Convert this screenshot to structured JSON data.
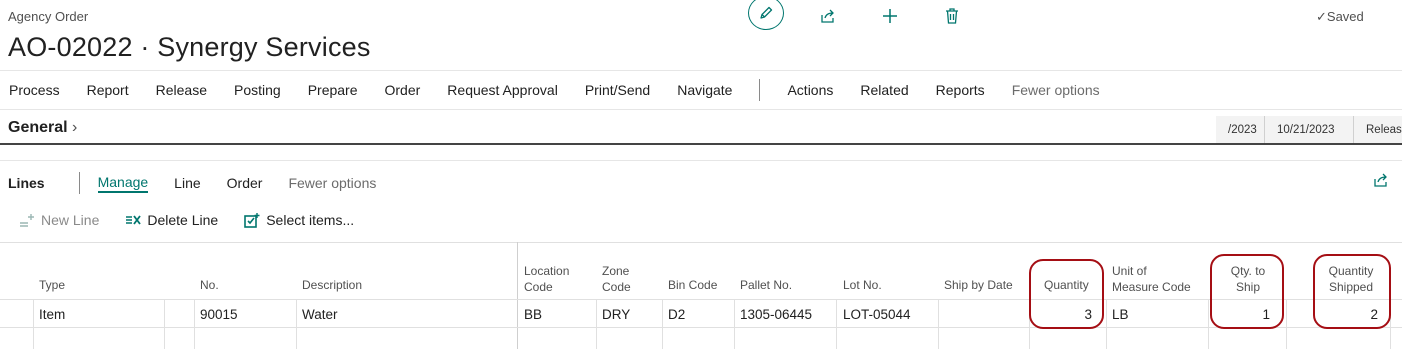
{
  "header": {
    "breadcrumb": "Agency Order",
    "title": "AO-02022 · Synergy Services",
    "saved_status": "Saved"
  },
  "actionbar": {
    "items": [
      "Process",
      "Report",
      "Release",
      "Posting",
      "Prepare",
      "Order",
      "Request Approval",
      "Print/Send",
      "Navigate"
    ],
    "secondary": [
      "Actions",
      "Related",
      "Reports"
    ],
    "fewer": "Fewer options"
  },
  "general": {
    "label": "General",
    "cells": [
      "/2023",
      "10/21/2023",
      "Releas"
    ]
  },
  "lines": {
    "label": "Lines",
    "tabs": [
      "Manage",
      "Line",
      "Order"
    ],
    "fewer": "Fewer options",
    "toolbar": {
      "new_line": "New Line",
      "delete_line": "Delete Line",
      "select_items": "Select items..."
    },
    "columns": {
      "type": "Type",
      "no": "No.",
      "description": "Description",
      "location_code_1": "Location",
      "location_code_2": "Code",
      "zone_code_1": "Zone",
      "zone_code_2": "Code",
      "bin_code": "Bin Code",
      "pallet_no": "Pallet No.",
      "lot_no": "Lot No.",
      "ship_by_date": "Ship by Date",
      "quantity": "Quantity",
      "uom_1": "Unit of",
      "uom_2": "Measure Code",
      "qty_to_ship_1": "Qty. to",
      "qty_to_ship_2": "Ship",
      "qty_shipped_1": "Quantity",
      "qty_shipped_2": "Shipped"
    },
    "row": {
      "type": "Item",
      "no": "90015",
      "description": "Water",
      "location_code": "BB",
      "zone_code": "DRY",
      "bin_code": "D2",
      "pallet_no": "1305-06445",
      "lot_no": "LOT-05044",
      "ship_by_date": "",
      "quantity": "3",
      "uom": "LB",
      "qty_to_ship": "1",
      "qty_shipped": "2"
    }
  },
  "colors": {
    "accent": "#00766e",
    "highlight_red": "#a50e14"
  }
}
